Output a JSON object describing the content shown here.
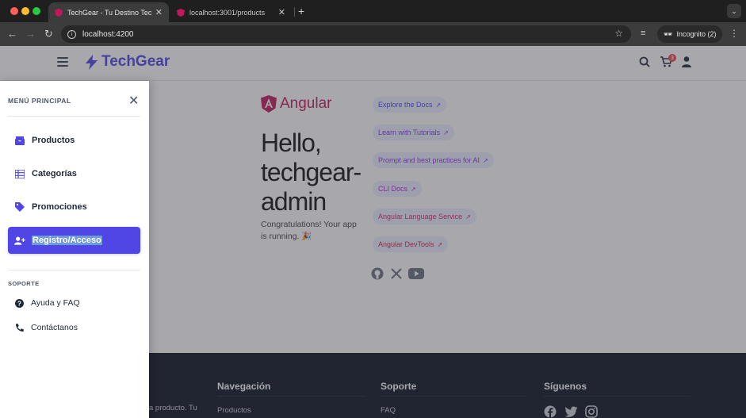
{
  "browser": {
    "tabs": [
      {
        "title": "TechGear - Tu Destino Tecnológico",
        "active": true
      },
      {
        "title": "localhost:3001/products",
        "active": false
      }
    ],
    "url": "localhost:4200",
    "incognito_label": "Incognito (2)"
  },
  "header": {
    "brand": "TechGear",
    "cart_count": "3"
  },
  "welcome": {
    "logo_text": "Angular",
    "greeting": "Hello, techgear-admin",
    "congrats": "Congratulations! Your app is running. 🎉",
    "links": [
      {
        "label": "Explore the Docs",
        "color": "#4f46e5"
      },
      {
        "label": "Learn with Tutorials",
        "color": "#7c3aed"
      },
      {
        "label": "Prompt and best practices for AI",
        "color": "#9333ea"
      },
      {
        "label": "CLI Docs",
        "color": "#c026d3"
      },
      {
        "label": "Angular Language Service",
        "color": "#db2777"
      },
      {
        "label": "Angular DevTools",
        "color": "#e11d48"
      }
    ]
  },
  "footer": {
    "snippet": "a producto. Tu",
    "columns": [
      {
        "heading": "Navegación",
        "first_link": "Productos"
      },
      {
        "heading": "Soporte",
        "first_link": "FAQ"
      },
      {
        "heading": "Síguenos"
      }
    ]
  },
  "drawer": {
    "title": "MENÚ PRINCIPAL",
    "items": [
      {
        "label": "Productos",
        "icon": "box-icon"
      },
      {
        "label": "Categorías",
        "icon": "list-icon"
      },
      {
        "label": "Promociones",
        "icon": "tag-icon"
      },
      {
        "label": "Registro/Acceso",
        "icon": "user-plus-icon",
        "active": true
      }
    ],
    "support_title": "SOPORTE",
    "support_items": [
      {
        "label": "Ayuda y FAQ",
        "icon": "question-icon"
      },
      {
        "label": "Contáctanos",
        "icon": "phone-icon"
      }
    ]
  },
  "colors": {
    "brand": "#4f46e5",
    "footer_bg": "#0b1120"
  }
}
